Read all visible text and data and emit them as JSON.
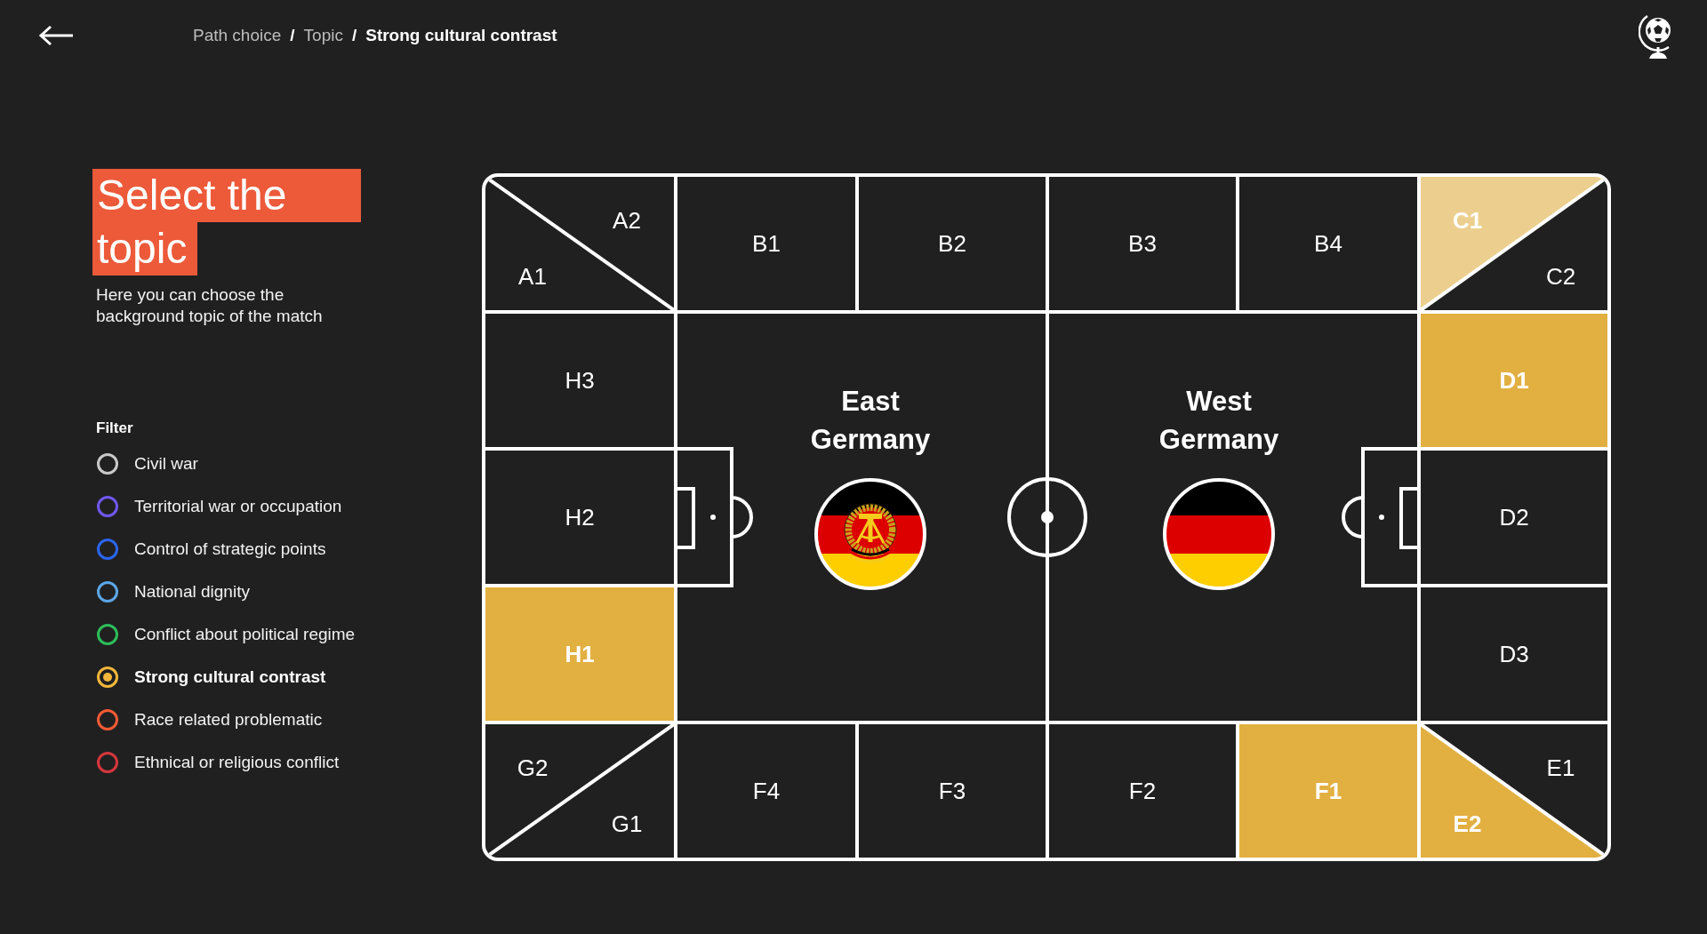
{
  "header": {
    "breadcrumb": [
      {
        "label": "Path choice",
        "separator": "/",
        "current": false
      },
      {
        "label": "Topic",
        "separator": "/",
        "current": false
      },
      {
        "label": "Strong cultural contrast",
        "current": true
      }
    ]
  },
  "intro": {
    "title": "Select the topic",
    "subtitle": "Here you can choose the background topic of the match"
  },
  "filter": {
    "label": "Filter",
    "options": [
      {
        "label": "Civil war",
        "color": "#c9c9c9",
        "selected": false
      },
      {
        "label": "Territorial war or occupation",
        "color": "#7157f0",
        "selected": false
      },
      {
        "label": "Control of strategic points",
        "color": "#2a65ef",
        "selected": false
      },
      {
        "label": "National dignity",
        "color": "#5ba6e6",
        "selected": false
      },
      {
        "label": "Conflict about political regime",
        "color": "#2cbd5a",
        "selected": false
      },
      {
        "label": "Strong cultural contrast",
        "color": "#f2b73a",
        "selected": true
      },
      {
        "label": "Race related problematic",
        "color": "#f45a35",
        "selected": false
      },
      {
        "label": "Ethnical or religious conflict",
        "color": "#d6363c",
        "selected": false
      }
    ]
  },
  "pitch": {
    "top_row": [
      {
        "kind": "split",
        "parts": [
          {
            "label": "A2"
          },
          {
            "label": "A1"
          }
        ]
      },
      {
        "kind": "cell",
        "label": "B1"
      },
      {
        "kind": "cell",
        "label": "B2"
      },
      {
        "kind": "cell",
        "label": "B3"
      },
      {
        "kind": "cell",
        "label": "B4"
      },
      {
        "kind": "split",
        "parts": [
          {
            "label": "C1",
            "color": "#eccf8e"
          },
          {
            "label": "C2"
          }
        ]
      }
    ],
    "left_column": [
      {
        "label": "H3"
      },
      {
        "label": "H2"
      },
      {
        "label": "H1",
        "color": "#e2b041"
      }
    ],
    "teams": [
      {
        "name": "East Germany",
        "kind": "emblem"
      },
      {
        "name": "West Germany",
        "kind": "plain"
      }
    ],
    "right_column": [
      {
        "label": "D1",
        "color": "#e2b041"
      },
      {
        "label": "D2"
      },
      {
        "label": "D3"
      }
    ],
    "bottom_row": [
      {
        "kind": "split",
        "parts": [
          {
            "label": "G2"
          },
          {
            "label": "G1"
          }
        ]
      },
      {
        "kind": "cell",
        "label": "F4"
      },
      {
        "kind": "cell",
        "label": "F3"
      },
      {
        "kind": "cell",
        "label": "F2"
      },
      {
        "kind": "cell",
        "label": "F1",
        "color": "#e2b041"
      },
      {
        "kind": "split",
        "parts": [
          {
            "label": "E1"
          },
          {
            "label": "E2",
            "color": "#e2b041"
          }
        ]
      }
    ]
  }
}
